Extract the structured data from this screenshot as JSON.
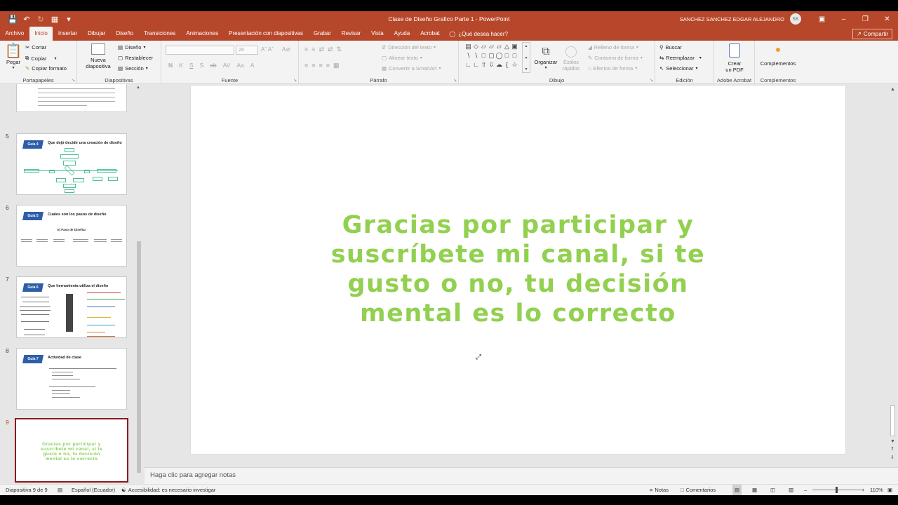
{
  "titlebar": {
    "title": "Clase de Diseño Grafico Parte 1  -  PowerPoint",
    "user": "SANCHEZ SANCHEZ EDGAR ALEJANDRO",
    "avatar": "SS",
    "qat_icons": [
      "save-icon",
      "undo-icon",
      "redo-icon",
      "present-icon",
      "customize-icon"
    ]
  },
  "tabs": [
    "Archivo",
    "Inicio",
    "Insertar",
    "Dibujar",
    "Diseño",
    "Transiciones",
    "Animaciones",
    "Presentación con diapositivas",
    "Grabar",
    "Revisar",
    "Vista",
    "Ayuda",
    "Acrobat"
  ],
  "active_tab": "Inicio",
  "tell_me": "¿Qué desea hacer?",
  "share": "Compartir",
  "ribbon": {
    "clipboard": {
      "label": "Portapapeles",
      "paste": "Pegar",
      "cut": "Cortar",
      "copy": "Copiar",
      "format_painter": "Copiar formato"
    },
    "slides": {
      "label": "Diapositivas",
      "new_slide_1": "Nueva",
      "new_slide_2": "diapositiva",
      "layout": "Diseño",
      "reset": "Restablecer",
      "section": "Sección"
    },
    "font": {
      "label": "Fuente",
      "size": "28",
      "buttons": [
        "N",
        "K",
        "S",
        "S",
        "ab",
        "AV",
        "Aa",
        "A"
      ]
    },
    "paragraph": {
      "label": "Párrafo",
      "text_direction": "Dirección del texto",
      "align_text": "Alinear texto",
      "smartart": "Convertir a SmartArt"
    },
    "drawing": {
      "label": "Dibujo",
      "arrange": "Organizar",
      "quick_styles_1": "Estilos",
      "quick_styles_2": "rápidos",
      "shape_fill": "Relleno de forma",
      "shape_outline": "Contorno de forma",
      "shape_effects": "Efectos de forma"
    },
    "editing": {
      "label": "Edición",
      "find": "Buscar",
      "replace": "Reemplazar",
      "select": "Seleccionar"
    },
    "acrobat": {
      "label": "Adobe Acrobat",
      "create_pdf_1": "Crear",
      "create_pdf_2": "un PDF"
    },
    "addins": {
      "label": "Complementos",
      "addins": "Complementos"
    }
  },
  "slides_pane": {
    "slides": [
      {
        "num": "5",
        "badge": "Guía 4",
        "title": "Que dejó decidir una creación de diseño"
      },
      {
        "num": "6",
        "badge": "Guía 5",
        "title": "Cuales son los pasos de diseño",
        "subtitle": "El Paso de Diseñar"
      },
      {
        "num": "7",
        "badge": "Guía 6",
        "title": "Que herramienta utiliza el diseño"
      },
      {
        "num": "8",
        "badge": "Guía 7",
        "title": "Actividad de clase"
      },
      {
        "num": "9",
        "text": "Gracias por participar y suscríbete mi canal, si te gusto o no, tu decisión mental es lo correcto"
      }
    ]
  },
  "slide": {
    "text": "Gracias por participar y suscríbete mi canal, si te gusto o no, tu decisión mental es lo correcto",
    "text_color": "#92d050"
  },
  "notes_placeholder": "Haga clic para agregar notas",
  "status": {
    "slide_info": "Diapositiva 9 de 9",
    "language": "Español (Ecuador)",
    "accessibility": "Accesibilidad: es necesario investigar",
    "notes": "Notas",
    "comments": "Comentarios",
    "zoom": "110%"
  },
  "colors": {
    "accent": "#b7472a",
    "slide_text": "#92d050"
  }
}
